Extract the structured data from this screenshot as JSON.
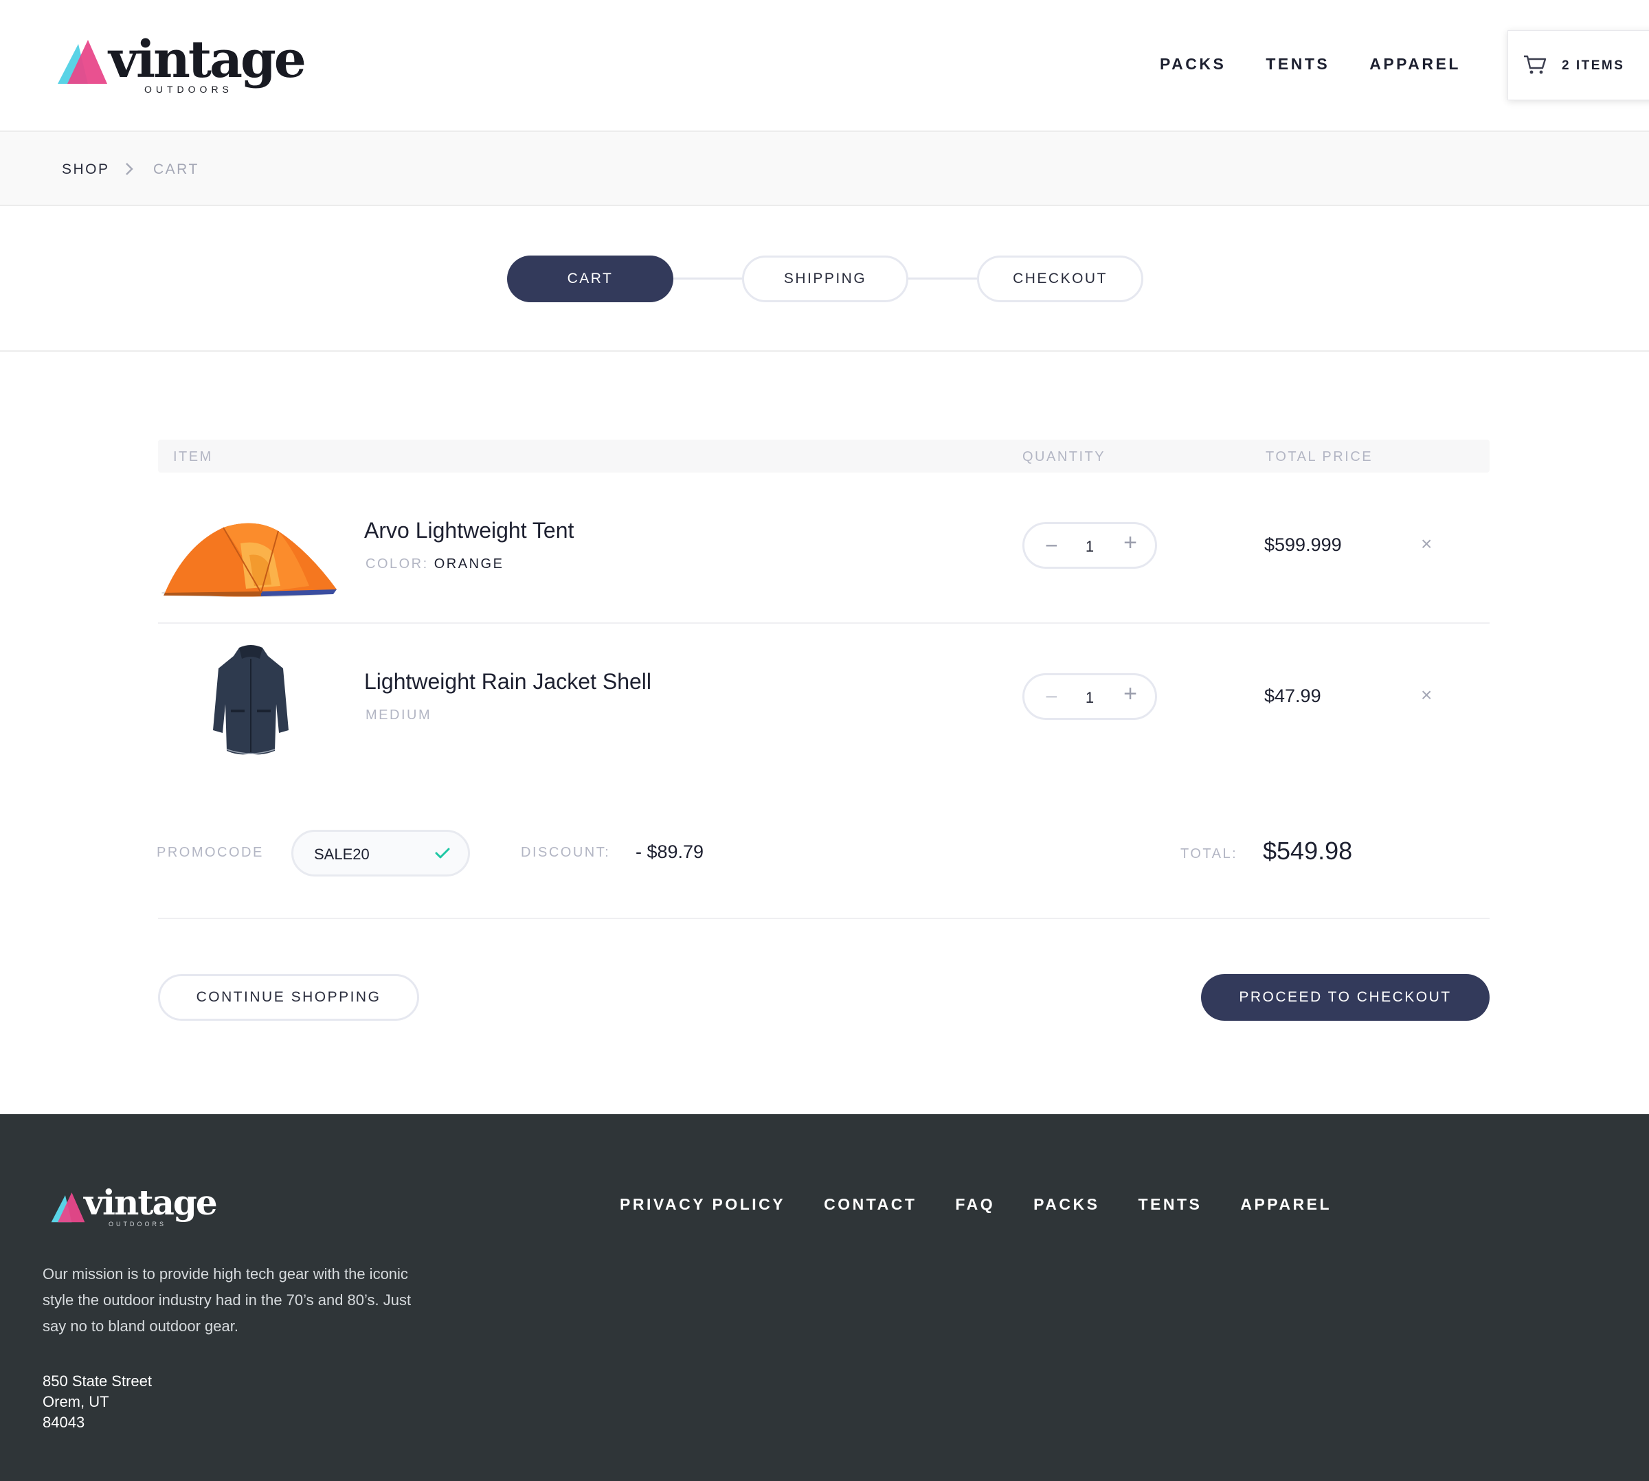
{
  "brand": {
    "name": "vintage",
    "tagline": "OUTDOORS",
    "colors": {
      "pink": "#e8488a",
      "cyan": "#5ad3e6",
      "navy": "#333a5b",
      "footer_bg": "#2f3538",
      "check_green": "#1fc7a4"
    }
  },
  "header": {
    "nav": [
      "PACKS",
      "TENTS",
      "APPAREL"
    ],
    "cart": {
      "icon": "cart-icon",
      "label": "2 ITEMS"
    }
  },
  "breadcrumb": {
    "items": [
      "SHOP",
      "CART"
    ],
    "separator_icon": "chevron-right-icon"
  },
  "steps": [
    {
      "label": "CART",
      "active": true
    },
    {
      "label": "SHIPPING",
      "active": false
    },
    {
      "label": "CHECKOUT",
      "active": false
    }
  ],
  "table": {
    "headers": {
      "item": "ITEM",
      "quantity": "QUANTITY",
      "total": "TOTAL PRICE"
    },
    "items": [
      {
        "name": "Arvo Lightweight Tent",
        "meta_label": "COLOR:",
        "meta_value": "ORANGE",
        "image": "orange-tent-image",
        "quantity": "1",
        "price": "$599.999"
      },
      {
        "name": "Lightweight Rain Jacket Shell",
        "meta_label": "MEDIUM",
        "meta_value": "",
        "image": "rain-jacket-image",
        "quantity": "1",
        "price": "$47.99"
      }
    ],
    "quantity_controls": {
      "minus": "−",
      "plus": "+"
    },
    "remove_glyph": "×"
  },
  "summary": {
    "promo_label": "PROMOCODE",
    "promo_code": "SALE20",
    "promo_icon": "check-icon",
    "discount_label": "DISCOUNT:",
    "discount_value": "- $89.79",
    "total_label": "TOTAL:",
    "total_value": "$549.98"
  },
  "actions": {
    "continue": "CONTINUE SHOPPING",
    "checkout": "PROCEED TO CHECKOUT"
  },
  "footer": {
    "nav": [
      "PRIVACY POLICY",
      "CONTACT",
      "FAQ",
      "PACKS",
      "TENTS",
      "APPAREL"
    ],
    "mission": "Our  mission is to provide high tech gear with the iconic style the outdoor industry had in the 70’s and 80’s. Just say no to bland outdoor gear.",
    "address": [
      "850 State Street",
      "Orem, UT",
      "84043"
    ]
  }
}
